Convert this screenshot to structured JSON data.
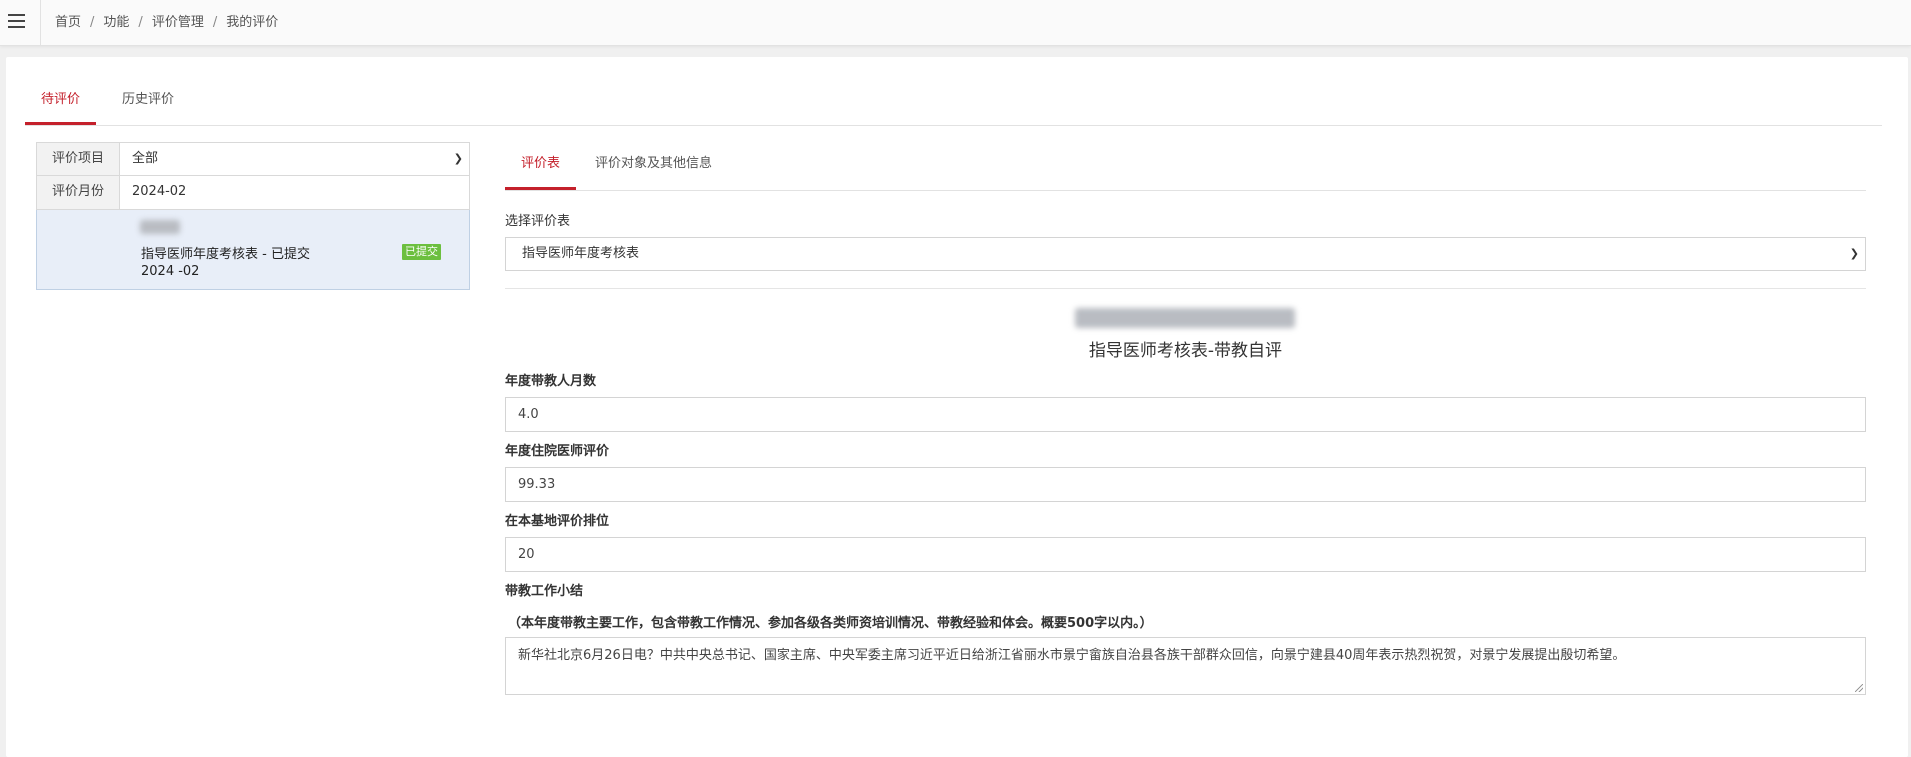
{
  "breadcrumb": [
    "首页",
    "功能",
    "评价管理",
    "我的评价"
  ],
  "top_tabs": [
    {
      "label": "待评价",
      "active": true
    },
    {
      "label": "历史评价",
      "active": false
    }
  ],
  "filters": {
    "project_label": "评价项目",
    "project_value": "全部",
    "month_label": "评价月份",
    "month_value": "2024-02"
  },
  "list_item": {
    "title": "指导医师年度考核表 - 已提交",
    "month": "2024 -02",
    "badge": "已提交",
    "badge_color": "#6cbf3f"
  },
  "sub_tabs": [
    {
      "label": "评价表",
      "active": true
    },
    {
      "label": "评价对象及其他信息",
      "active": false
    }
  ],
  "form_select": {
    "label": "选择评价表",
    "value": "指导医师年度考核表"
  },
  "form": {
    "title": "指导医师考核表-带教自评",
    "fields": [
      {
        "label": "年度带教人月数",
        "value": "4.0"
      },
      {
        "label": "年度住院医师评价",
        "value": "99.33"
      },
      {
        "label": "在本基地评价排位",
        "value": "20"
      }
    ],
    "summary_label": "带教工作小结",
    "summary_hint": "（本年度带教主要工作，包含带教工作情况、参加各级各类师资培训情况、带教经验和体会。概要500字以内。）",
    "summary_text": "新华社北京6月26日电？中共中央总书记、国家主席、中央军委主席习近平近日给浙江省丽水市景宁畲族自治县各族干部群众回信，向景宁建县40周年表示热烈祝贺，对景宁发展提出殷切希望。"
  },
  "colors": {
    "accent": "#c4202b",
    "selected_item_bg": "#e8eef8"
  },
  "icons": [
    "menu-icon",
    "chevron-down-icon",
    "resize-handle-icon"
  ]
}
